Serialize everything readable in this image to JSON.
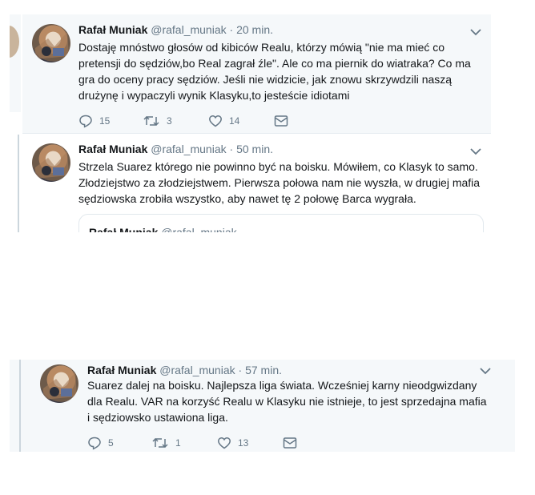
{
  "author": {
    "name": "Rafał Muniak",
    "handle": "@rafal_muniak"
  },
  "separator": "·",
  "tweets": [
    {
      "time": "20 min.",
      "text": "Dostaję mnóstwo głosów od kibiców Realu, którzy mówią \"nie ma mieć co pretensji do sędziów,bo Real zagrał źle\". Ale co ma piernik do wiatraka? Co ma gra do oceny pracy sędziów. Jeśli nie widzicie, jak znowu skrzywdzili naszą drużynę i wypaczyli wynik Klasyku,to jesteście idiotami",
      "replies": "15",
      "retweets": "3",
      "likes": "14"
    },
    {
      "time": "50 min.",
      "text": "Strzela Suarez którego nie powinno być na boisku. Mówiłem, co Klasyk to samo. Złodziejstwo za złodziejstwem. Pierwsza połowa nam nie wyszła, w drugiej mafia sędziowska zrobiła wszystko, aby nawet tę 2 połowę Barca wygrała.",
      "quote_name": "Rafał Muniak",
      "quote_handle": "@rafal_muniak"
    },
    {
      "time": "57 min.",
      "text": "Suarez dalej na boisku. Najlepsza liga świata. Wcześniej karny nieodgwizdany dla Realu. VAR na korzyść Realu w Klasyku nie istnieje, to jest sprzedajna mafia i sędziowsko ustawiona liga.",
      "replies": "5",
      "retweets": "1",
      "likes": "13"
    }
  ],
  "icons": {
    "reply": "reply-icon",
    "retweet": "retweet-icon",
    "like": "heart-icon",
    "dm": "envelope-icon",
    "more": "chevron-down-icon"
  },
  "colors": {
    "highlight_bg": "#f5f8fa",
    "name": "#14171a",
    "muted": "#657786",
    "border": "#e6ecf0"
  }
}
